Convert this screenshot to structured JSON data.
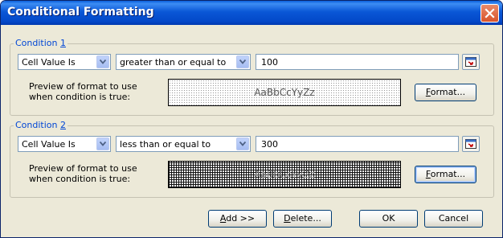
{
  "dialog": {
    "title": "Conditional Formatting",
    "close_label": "close"
  },
  "conditions": [
    {
      "label_prefix": "Condition ",
      "label_number": "1",
      "type": "Cell Value Is",
      "operator": "greater than or equal to",
      "value": "100",
      "preview_label_line1": "Preview of format to use",
      "preview_label_line2": "when condition is true:",
      "preview_text": "AaBbCcYyZz",
      "format_button": {
        "accel": "F",
        "rest": "ormat..."
      }
    },
    {
      "label_prefix": "Condition ",
      "label_number": "2",
      "type": "Cell Value Is",
      "operator": "less than or equal to",
      "value": "300",
      "preview_label_line1": "Preview of format to use",
      "preview_label_line2": "when condition is true:",
      "preview_text": "AaBbCcYyZz",
      "format_button": {
        "accel": "F",
        "rest": "ormat..."
      }
    }
  ],
  "footer": {
    "add": {
      "accel": "A",
      "rest": "dd >>"
    },
    "delete": {
      "accel": "D",
      "rest": "elete..."
    },
    "ok": "OK",
    "cancel": "Cancel"
  },
  "colors": {
    "title_bar": "#0a57d6",
    "group_label": "#0046d5",
    "dialog_bg": "#ece9d8",
    "close_button": "#d9542b"
  }
}
